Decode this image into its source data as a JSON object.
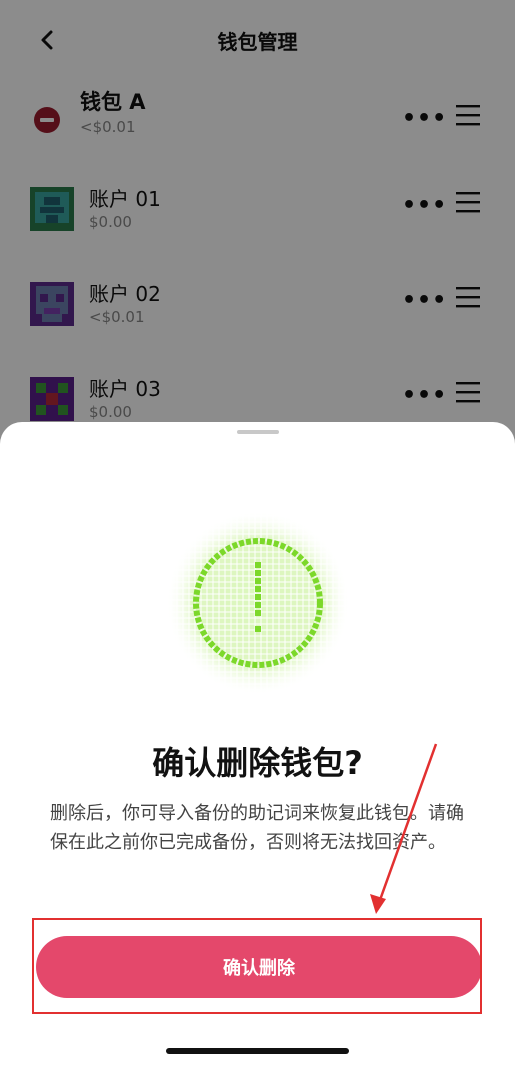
{
  "header": {
    "title": "钱包管理",
    "back_icon": "chevron-left-icon"
  },
  "wallet": {
    "name": "钱包 A",
    "balance": "<$0.01",
    "remove_icon": "minus-circle-icon",
    "remove_color": "#9b1c2e"
  },
  "accounts": [
    {
      "name": "账户 01",
      "balance": "$0.00"
    },
    {
      "name": "账户 02",
      "balance": "<$0.01"
    },
    {
      "name": "账户 03",
      "balance": "$0.00"
    }
  ],
  "row_actions": {
    "more_label": "•••",
    "drag_icon": "drag-handle-icon"
  },
  "dialog": {
    "icon": "warning-pixel-icon",
    "icon_color": "#7cd82a",
    "title": "确认删除钱包?",
    "description": "删除后，你可导入备份的助记词来恢复此钱包。请确保在此之前你已完成备份，否则将无法找回资产。",
    "confirm_label": "确认删除",
    "confirm_color": "#e4486b"
  },
  "annotation": {
    "color": "#e23030"
  }
}
